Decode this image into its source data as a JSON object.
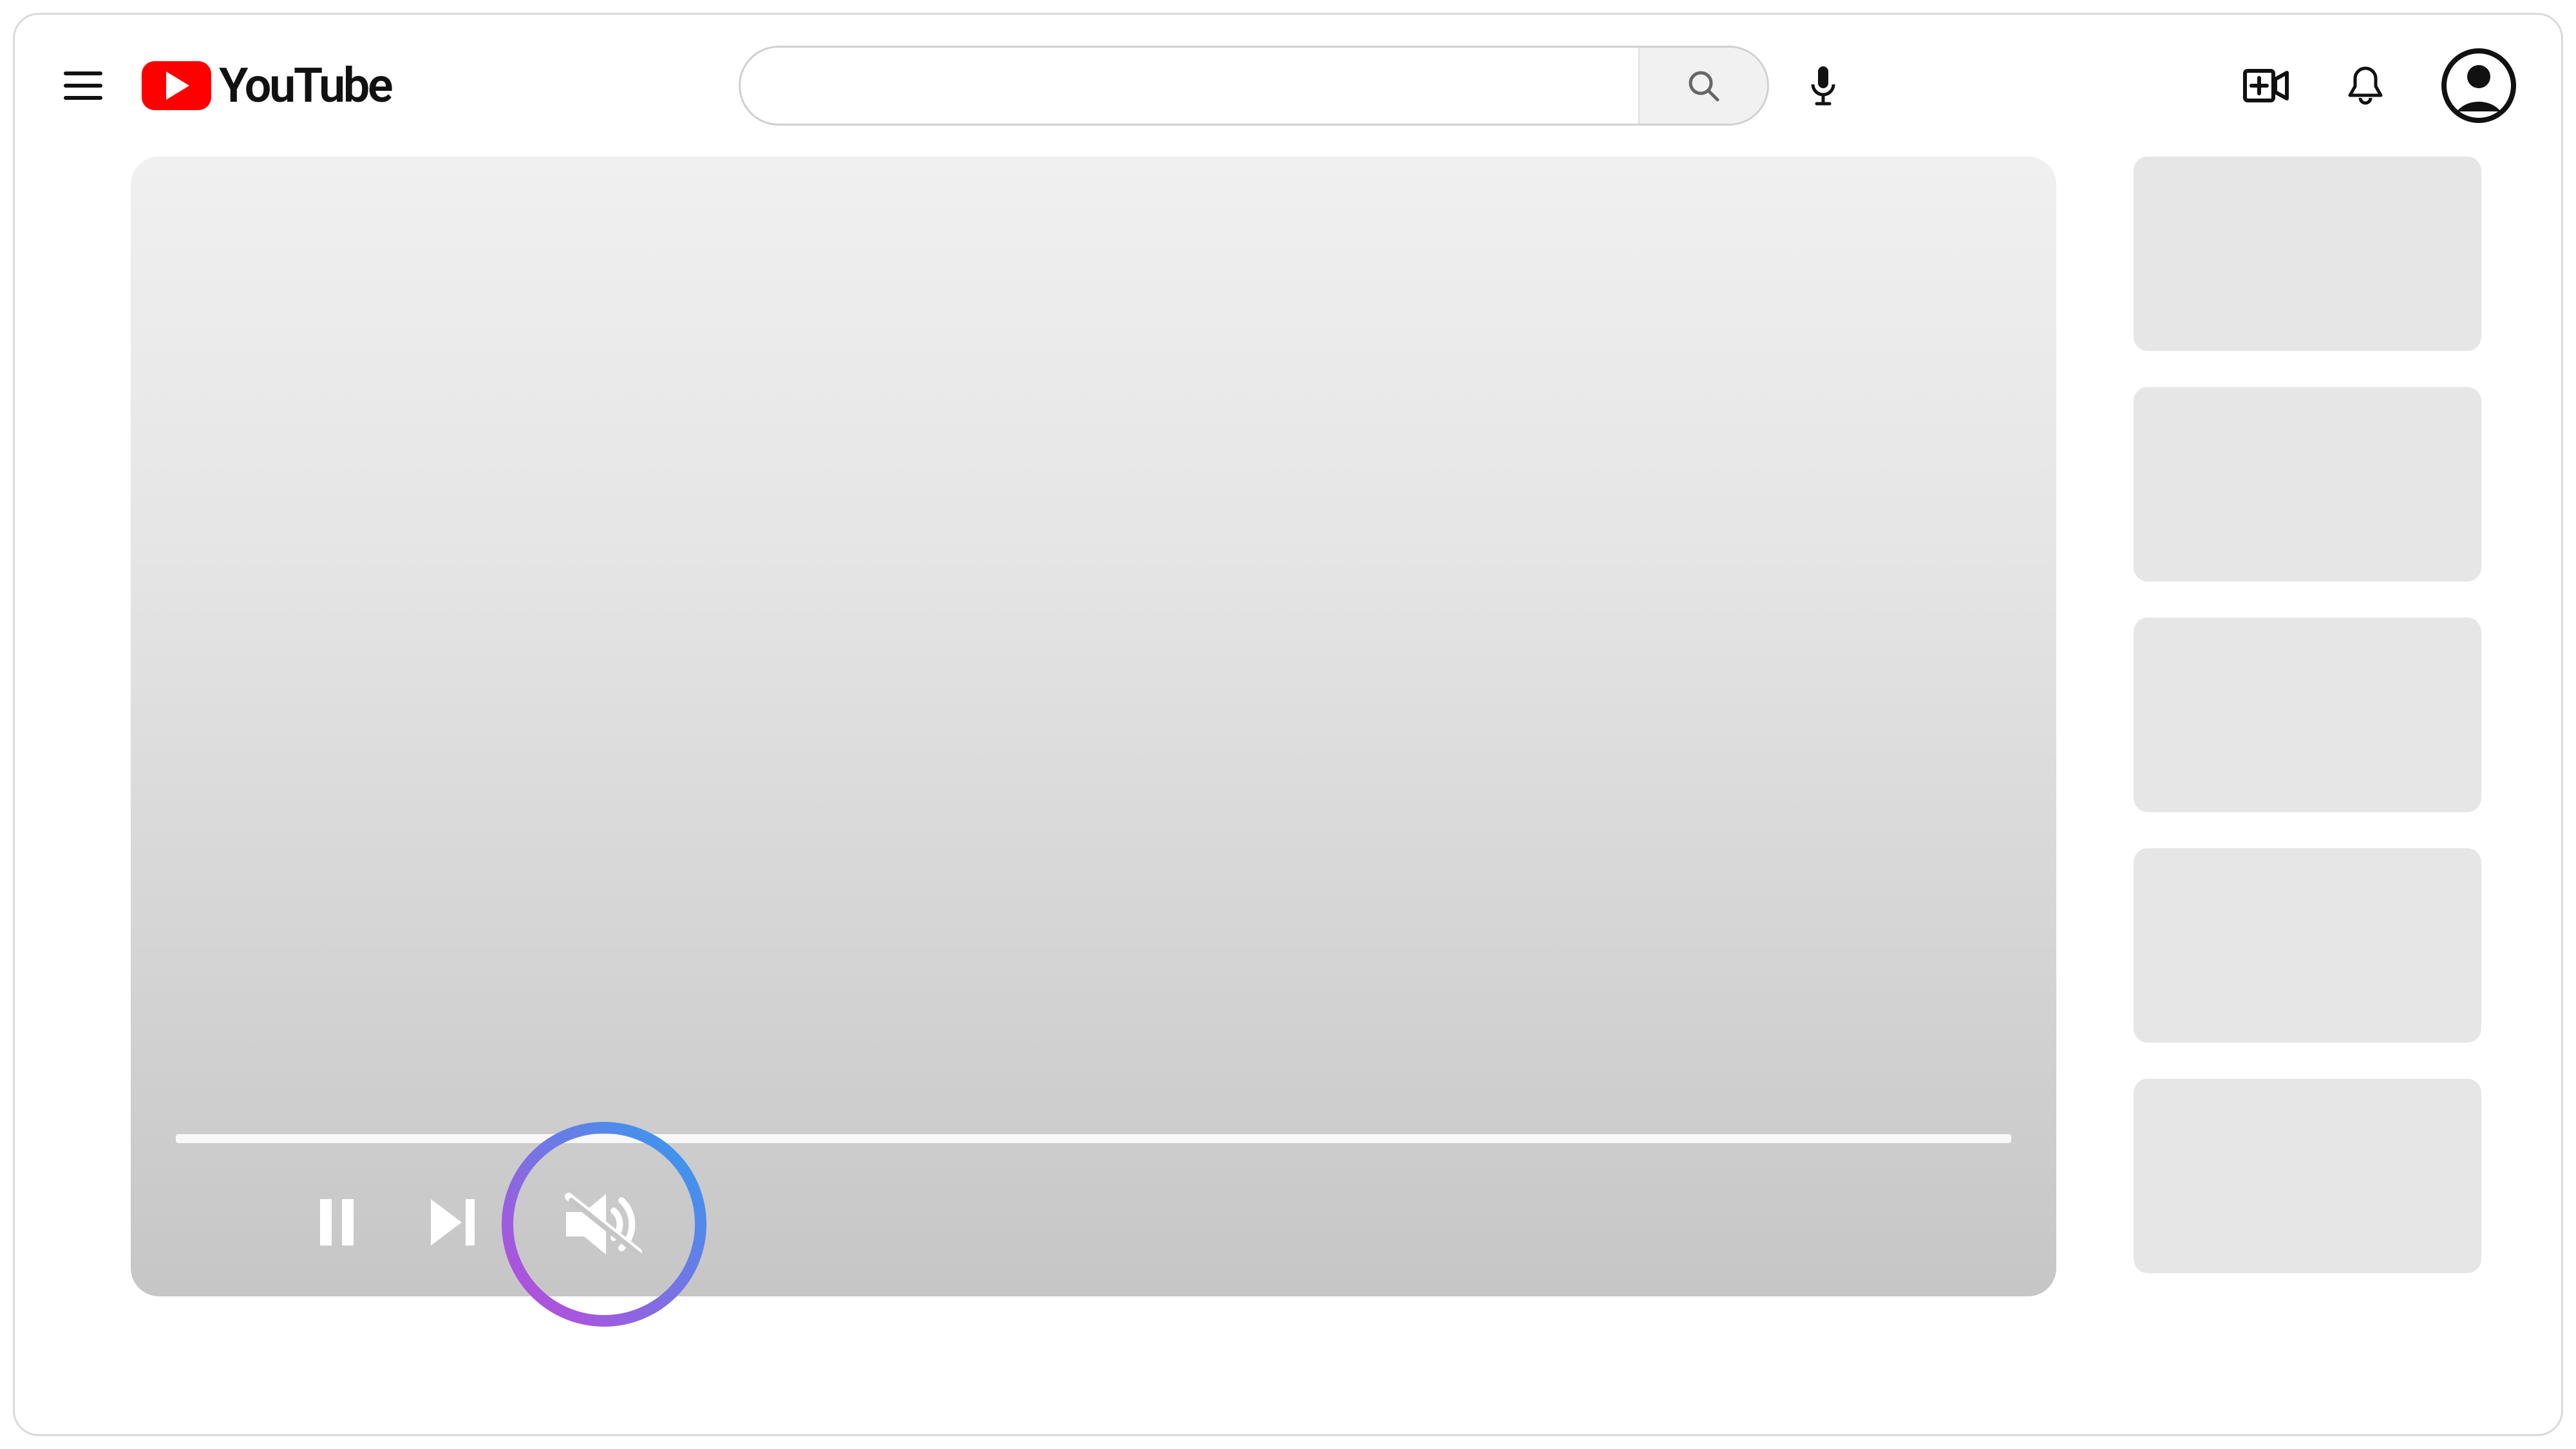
{
  "brand": {
    "name": "YouTube",
    "accent_color": "#ff0000"
  },
  "search": {
    "value": "",
    "placeholder": ""
  },
  "player": {
    "progress_percent": 0,
    "controls": {
      "pause": "pause",
      "next": "next",
      "mute": "mute"
    },
    "highlighted_control": "mute"
  },
  "recommendations": {
    "count": 5
  },
  "highlight_gradient": {
    "from": "#c147d9",
    "to": "#2f9ef0"
  }
}
